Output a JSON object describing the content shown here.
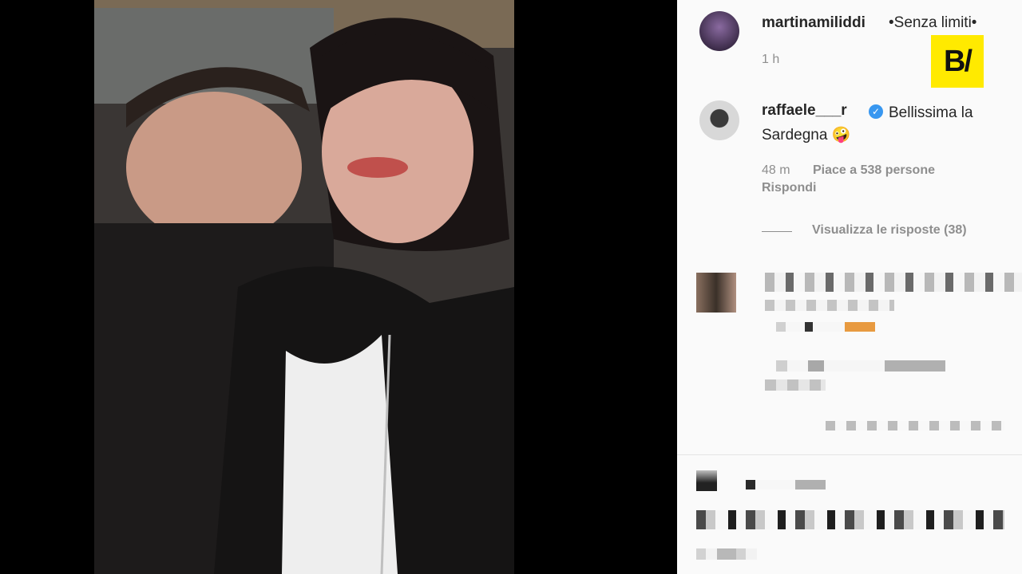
{
  "post": {
    "author": "martinamiliddi",
    "caption": "•Senza limiti•",
    "time": "1 h"
  },
  "watermark": {
    "logo_text": "B/"
  },
  "comment": {
    "author": "raffaele___r",
    "verified_mark": "✓",
    "text": "Bellissima la Sardegna 🤪",
    "time": "48 m",
    "likes": "Piace a 538 persone",
    "reply_label": "Rispondi",
    "view_replies_label": "Visualizza le risposte (38)"
  },
  "colors": {
    "verified": "#3897f0",
    "panel_bg": "#fafafa",
    "logo_bg": "#ffea00"
  },
  "icons": {
    "verified": "verified-badge-icon"
  }
}
